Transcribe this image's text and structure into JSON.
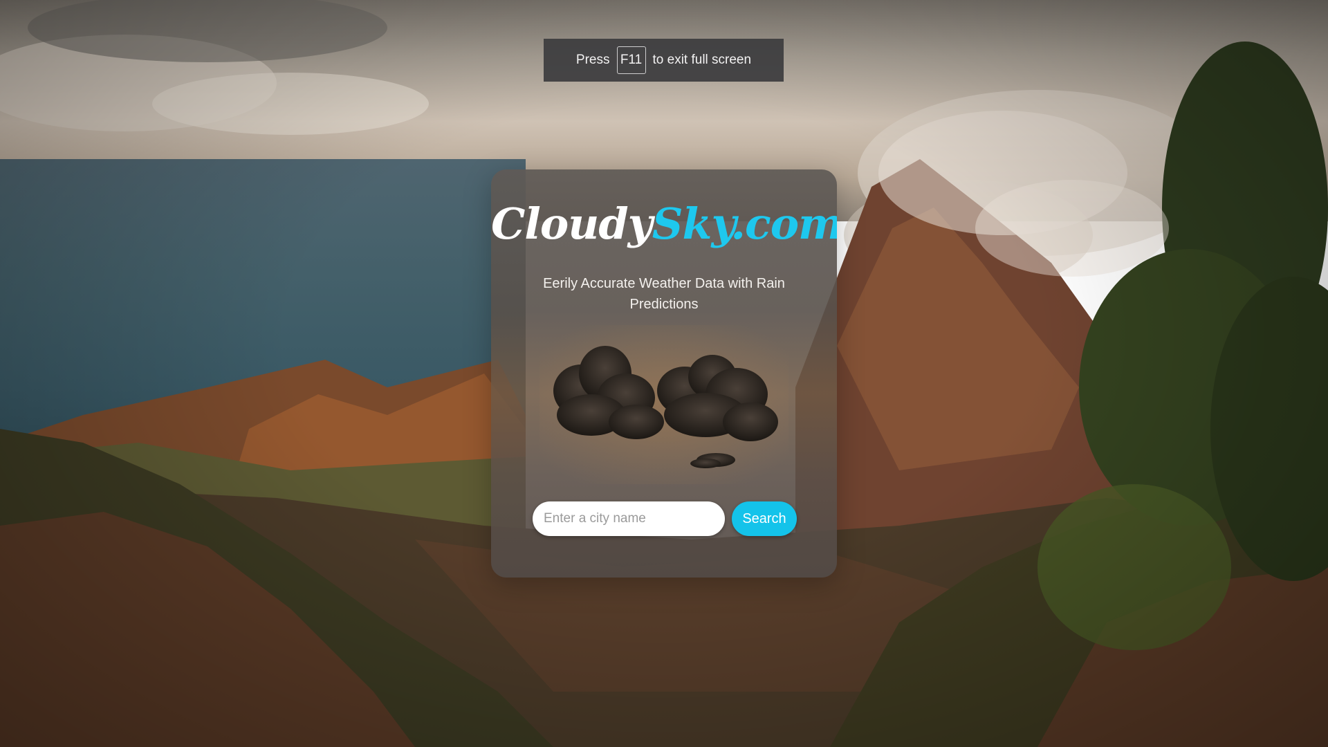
{
  "fullscreen_notice": {
    "prefix": "Press",
    "key": "F11",
    "suffix": "to exit full screen"
  },
  "card": {
    "logo_part1": "Cloudy",
    "logo_part2": "Sky.com",
    "tagline": "Eerily Accurate Weather Data with Rain Predictions"
  },
  "search": {
    "placeholder": "Enter a city name",
    "value": "",
    "button_label": "Search"
  },
  "colors": {
    "accent": "#14c3ea",
    "logo_accent": "#1ec8ee",
    "toast_bg": "#3c3c3e"
  },
  "icons": {
    "weather_art": "dark-clouds-illustration"
  }
}
